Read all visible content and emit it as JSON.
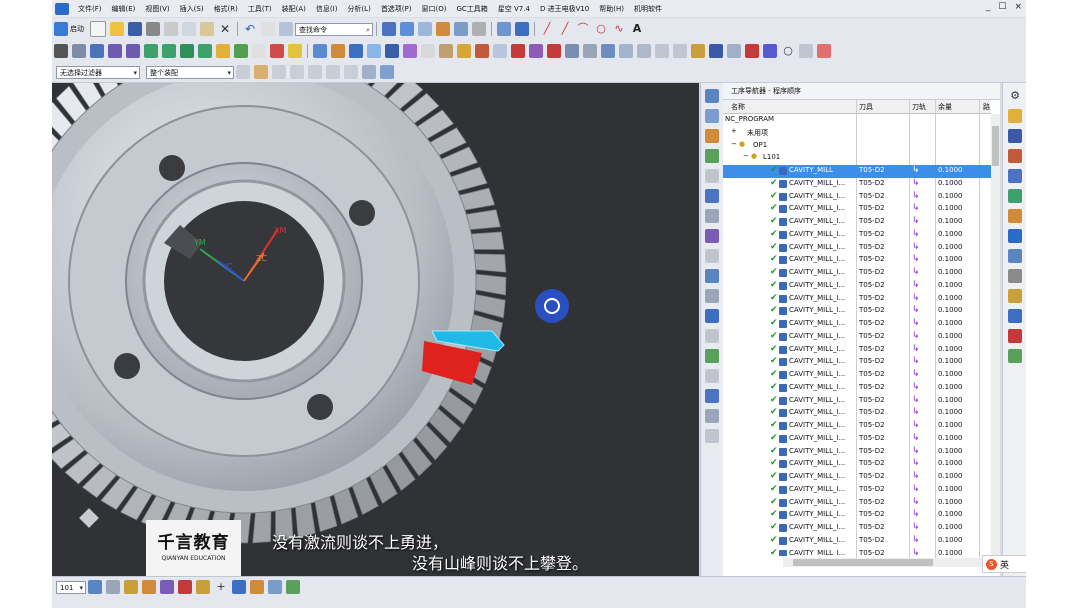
{
  "menu": [
    "文件(F)",
    "编辑(E)",
    "视图(V)",
    "插入(S)",
    "格式(R)",
    "工具(T)",
    "装配(A)",
    "信息(I)",
    "分析(L)",
    "首选项(P)",
    "窗口(O)",
    "GC工具箱",
    "星空 V7.4",
    "D 进王电极V10",
    "帮助(H)",
    "机明软件"
  ],
  "window_controls": [
    "_",
    "☐",
    "×"
  ],
  "toolbar": {
    "start_label": "启动",
    "command_search": "查找命令",
    "filter_select": "无选择过滤器",
    "assembly_select": "整个装配",
    "zoom_value": "101"
  },
  "navigator": {
    "title": "工序导航器 - 程序顺序",
    "columns": [
      "名称",
      "刀具",
      "刀轨",
      "余量",
      "路"
    ],
    "tree": {
      "root": "NC_PROGRAM",
      "unused": "未用项",
      "op1": "OP1",
      "l101": "L101"
    },
    "selected_op": {
      "name": "CAVITY_MILL",
      "tool": "T05-D2",
      "stock": "0.1000"
    },
    "ops": [
      {
        "name": "CAVITY_MILL_I...",
        "tool": "T05-D2",
        "stock": "0.1000"
      },
      {
        "name": "CAVITY_MILL_I...",
        "tool": "T05-D2",
        "stock": "0.1000"
      },
      {
        "name": "CAVITY_MILL_I...",
        "tool": "T05-D2",
        "stock": "0.1000"
      },
      {
        "name": "CAVITY_MILL_I...",
        "tool": "T05-D2",
        "stock": "0.1000"
      },
      {
        "name": "CAVITY_MILL_I...",
        "tool": "T05-D2",
        "stock": "0.1000"
      },
      {
        "name": "CAVITY_MILL_I...",
        "tool": "T05-D2",
        "stock": "0.1000"
      },
      {
        "name": "CAVITY_MILL_I...",
        "tool": "T05-D2",
        "stock": "0.1000"
      },
      {
        "name": "CAVITY_MILL_I...",
        "tool": "T05-D2",
        "stock": "0.1000"
      },
      {
        "name": "CAVITY_MILL_I...",
        "tool": "T05-D2",
        "stock": "0.1000"
      },
      {
        "name": "CAVITY_MILL_I...",
        "tool": "T05-D2",
        "stock": "0.1000"
      },
      {
        "name": "CAVITY_MILL_I...",
        "tool": "T05-D2",
        "stock": "0.1000"
      },
      {
        "name": "CAVITY_MILL_I...",
        "tool": "T05-D2",
        "stock": "0.1000"
      },
      {
        "name": "CAVITY_MILL_I...",
        "tool": "T05-D2",
        "stock": "0.1000"
      },
      {
        "name": "CAVITY_MILL_I...",
        "tool": "T05-D2",
        "stock": "0.1000"
      },
      {
        "name": "CAVITY_MILL_I...",
        "tool": "T05-D2",
        "stock": "0.1000"
      },
      {
        "name": "CAVITY_MILL_I...",
        "tool": "T05-D2",
        "stock": "0.1000"
      },
      {
        "name": "CAVITY_MILL_I...",
        "tool": "T05-D2",
        "stock": "0.1000"
      },
      {
        "name": "CAVITY_MILL_I...",
        "tool": "T05-D2",
        "stock": "0.1000"
      },
      {
        "name": "CAVITY_MILL_I...",
        "tool": "T05-D2",
        "stock": "0.1000"
      },
      {
        "name": "CAVITY_MILL_I...",
        "tool": "T05-D2",
        "stock": "0.1000"
      },
      {
        "name": "CAVITY_MILL_I...",
        "tool": "T05-D2",
        "stock": "0.1000"
      },
      {
        "name": "CAVITY_MILL_I...",
        "tool": "T05-D2",
        "stock": "0.1000"
      },
      {
        "name": "CAVITY_MILL_I...",
        "tool": "T05-D2",
        "stock": "0.1000"
      },
      {
        "name": "CAVITY_MILL_I...",
        "tool": "T05-D2",
        "stock": "0.1000"
      },
      {
        "name": "CAVITY_MILL_I...",
        "tool": "T05-D2",
        "stock": "0.1000"
      },
      {
        "name": "CAVITY_MILL_I...",
        "tool": "T05-D2",
        "stock": "0.1000"
      },
      {
        "name": "CAVITY_MILL_I...",
        "tool": "T05-D2",
        "stock": "0.1000"
      },
      {
        "name": "CAVITY_MILL_I...",
        "tool": "T05-D2",
        "stock": "0.1000"
      },
      {
        "name": "CAVITY_MILL_I...",
        "tool": "T05-D2",
        "stock": "0.1000"
      },
      {
        "name": "CAVITY_MILL_I...",
        "tool": "T05-D2",
        "stock": "0.1000"
      }
    ]
  },
  "viewport": {
    "axis_labels": {
      "xm": "XM",
      "ym": "YM",
      "zc": "ZC",
      "yc": "YC"
    },
    "subtitle_line1": "没有激流则谈不上勇进，",
    "subtitle_line2": "没有山峰则谈不上攀登。",
    "watermark_cn": "千言教育",
    "watermark_en": "QIANYAN EDUCATION"
  },
  "ime": {
    "label": "英"
  }
}
